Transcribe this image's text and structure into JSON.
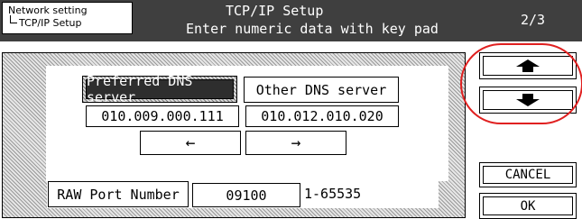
{
  "header": {
    "breadcrumb_top": "Network setting",
    "breadcrumb_sub": "TCP/IP Setup",
    "title": "TCP/IP Setup",
    "subtitle": "Enter numeric data with key pad",
    "page": "2/3"
  },
  "dns": {
    "preferred_label": "Preferred DNS server",
    "other_label": "Other DNS server",
    "preferred_value": "010.009.000.111",
    "other_value": "010.012.010.020",
    "left_arrow": "←",
    "right_arrow": "→"
  },
  "raw": {
    "label": "RAW Port Number",
    "value": "09100",
    "range": "1-65535"
  },
  "side": {
    "up_icon": "arrow-up-icon",
    "down_icon": "arrow-down-icon",
    "cancel_label": "CANCEL",
    "ok_label": "OK"
  },
  "colors": {
    "header_bg": "#3f3f3f",
    "annotation_ring": "#e02020"
  }
}
